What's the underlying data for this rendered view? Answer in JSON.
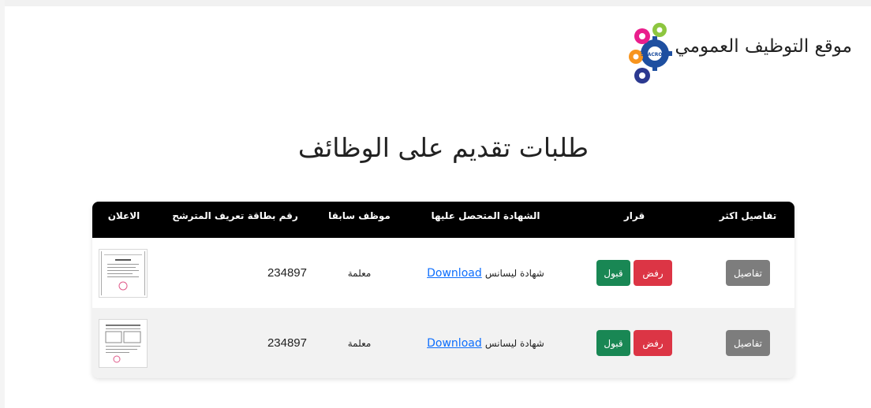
{
  "header": {
    "site_name": "موقع التوظيف العمومي",
    "logo_text": "SEACROFT",
    "logo_ring_text": "PRIMARY CARE NETWORK",
    "logo_colors": [
      "#1e4fa0",
      "#e91e8c",
      "#8dc63f",
      "#f7941d"
    ]
  },
  "page_title": "طلبات تقديم على الوظائف",
  "table": {
    "headers": {
      "details": "تفاصيل اكثر",
      "decision": "قرار",
      "certificate": "الشهادة المتحصل عليها",
      "formerly_employee": "موظف سابقا",
      "id_number": "رقم بطاقة تعريف المترشح",
      "announcement": "الاعلان"
    },
    "rows": [
      {
        "details_label": "تفاصيل",
        "reject_label": "رفض",
        "accept_label": "قبول",
        "download_label": "Download",
        "certificate": "شهادة ليسانس",
        "formerly": "معلمة",
        "id_number": "234897",
        "ad_icon": "document-thumbnail-icon"
      },
      {
        "details_label": "تفاصيل",
        "reject_label": "رفض",
        "accept_label": "قبول",
        "download_label": "Download",
        "certificate": "شهادة ليسانس",
        "formerly": "معلمة",
        "id_number": "234897",
        "ad_icon": "document-thumbnail-icon"
      }
    ]
  },
  "colors": {
    "details_button": "#7d7d7d",
    "reject_button": "#dc3545",
    "accept_button": "#198754",
    "link": "#0d6efd",
    "header_bg": "#000000"
  }
}
